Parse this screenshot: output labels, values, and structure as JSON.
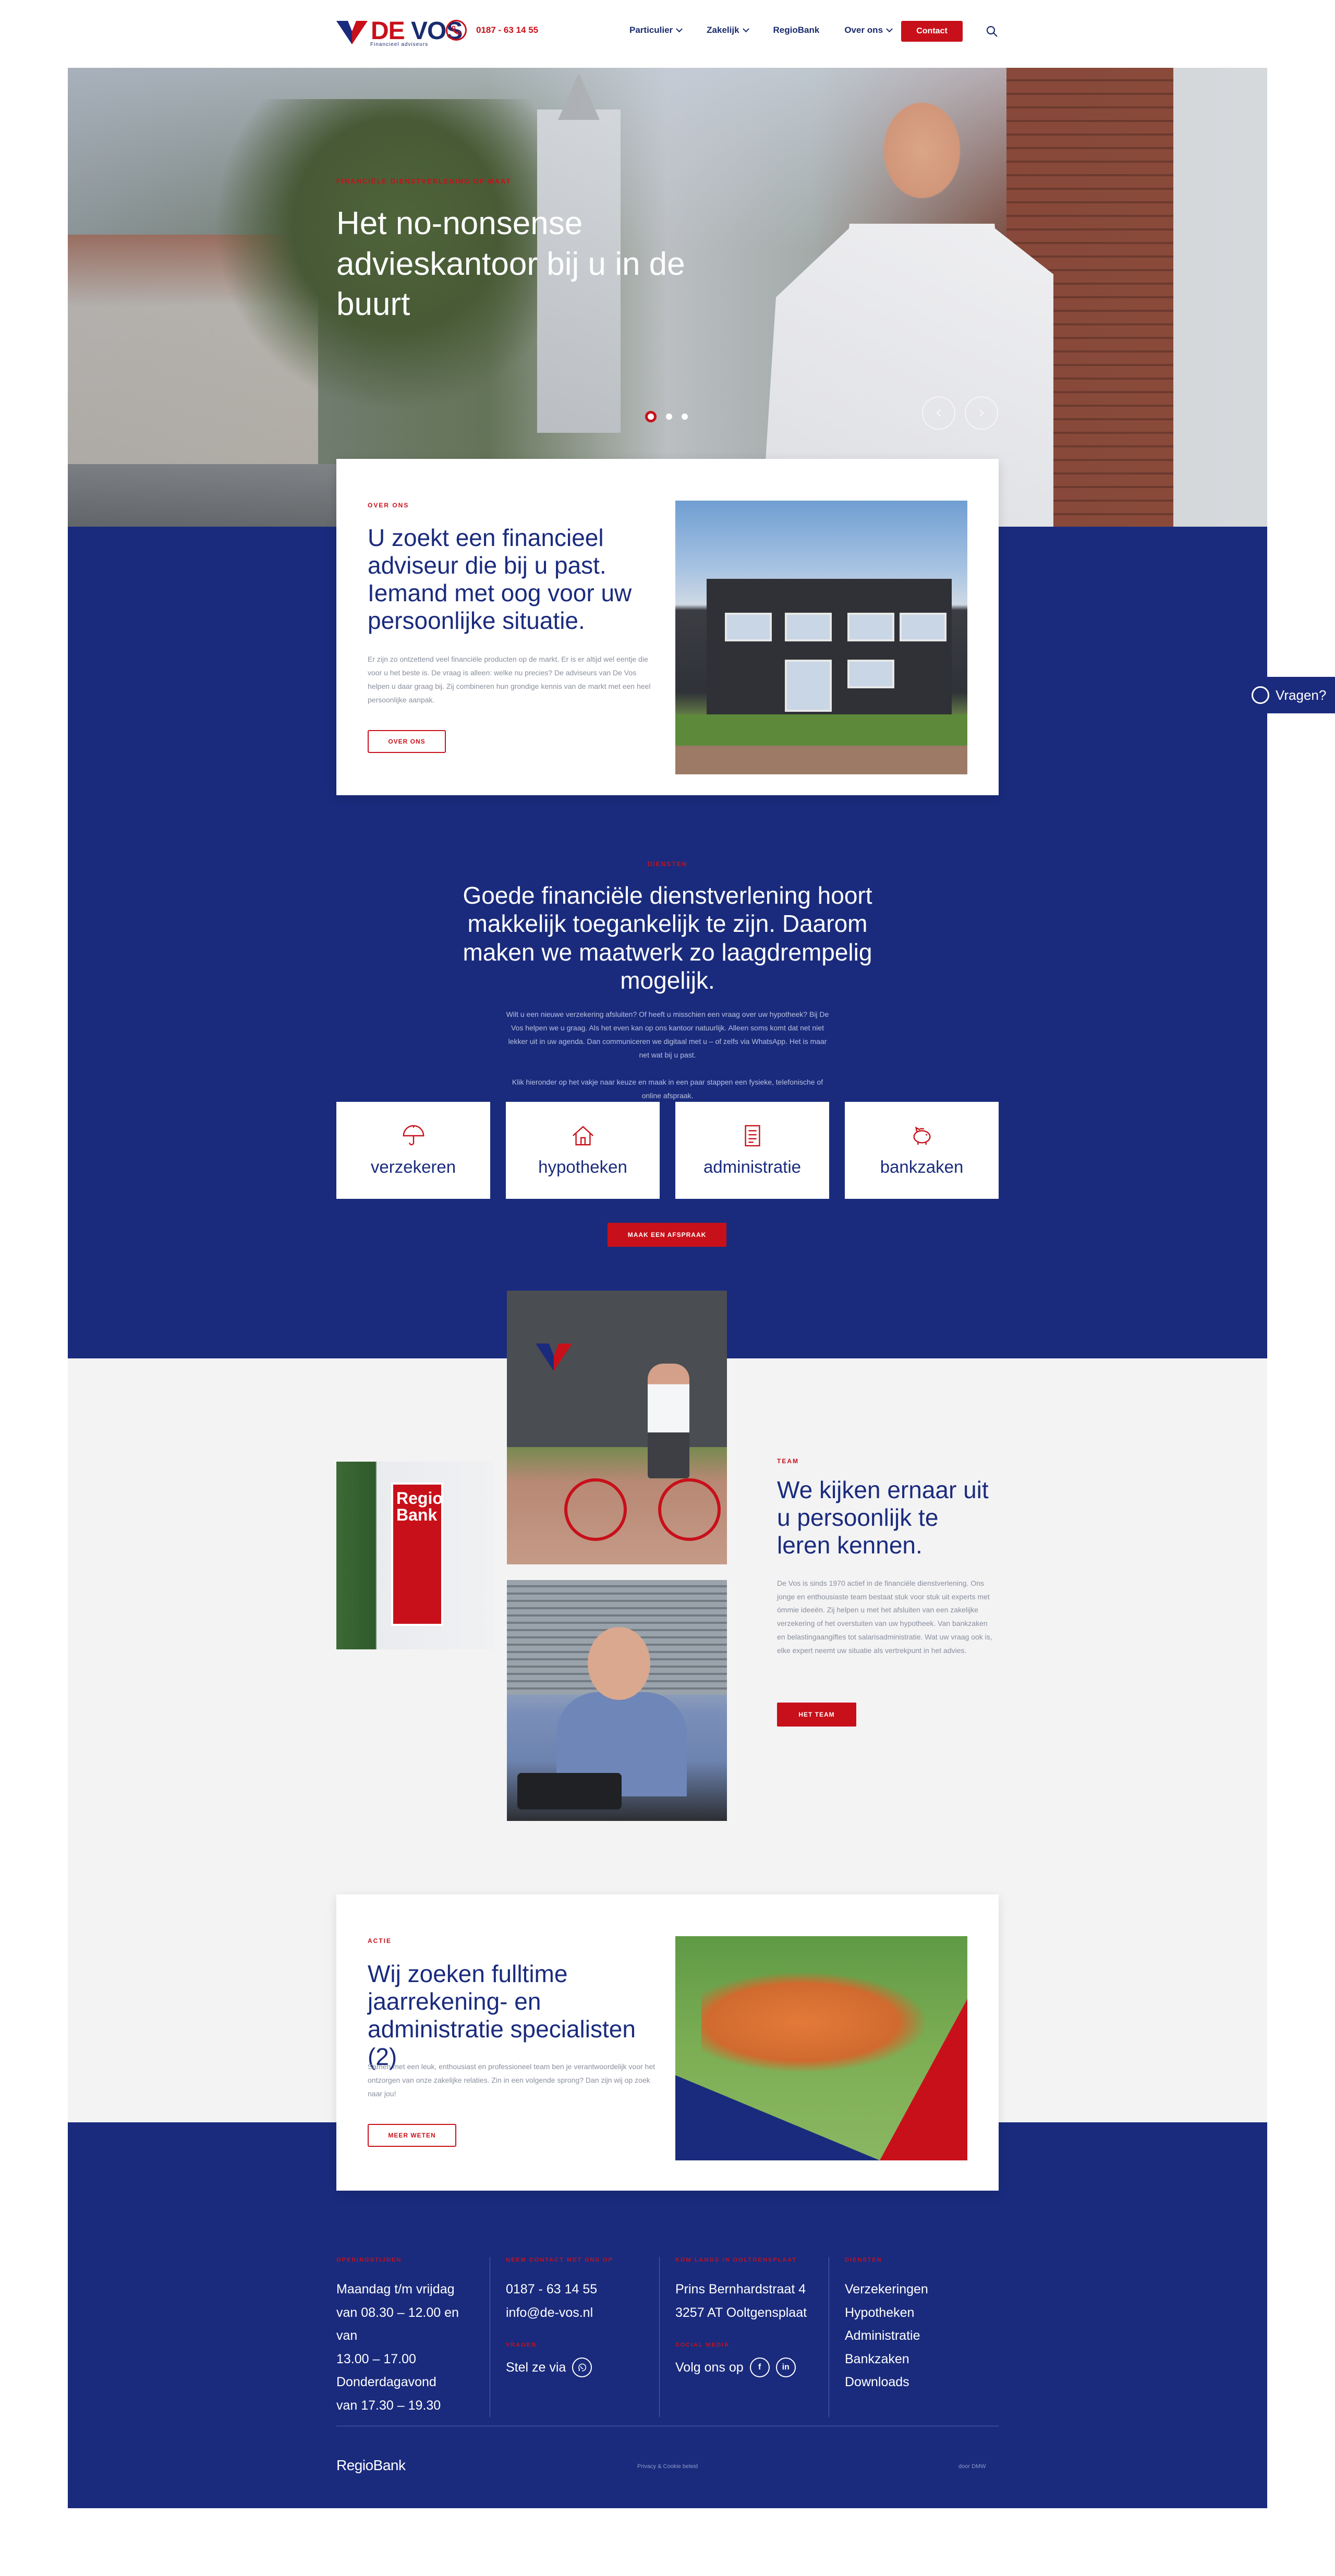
{
  "header": {
    "logo_text": "VOS",
    "logo_prefix": "DE",
    "logo_sub": "Financieel adviseurs",
    "phone": "0187 - 63 14 55",
    "nav": [
      "Particulier",
      "Zakelijk",
      "RegioBank",
      "Over ons"
    ],
    "contact_label": "Contact"
  },
  "hero": {
    "kicker": "FINANCIËLE DIENSTVERLENING OP MAAT",
    "title": "Het no-nonsense advieskantoor bij u in de buurt"
  },
  "about": {
    "kicker": "OVER ONS",
    "title": "U zoekt een financieel adviseur die bij u past. Iemand met oog voor uw persoonlijke situatie.",
    "text": "Er zijn zo ontzettend veel financiële producten op de markt. Er is er altijd wel eentje die voor u het beste is. De vraag is alleen: welke nu precies? De adviseurs van De Vos helpen u daar graag bij. Zij combineren hun grondige kennis van de markt met een heel persoonlijke aanpak.",
    "button": "OVER ONS"
  },
  "diensten": {
    "kicker": "DIENSTEN",
    "title": "Goede financiële dienstverlening hoort makkelijk toegankelijk te zijn. Daarom maken we maatwerk zo laagdrempelig mogelijk.",
    "text1": "Wilt u een nieuwe verzekering afsluiten? Of heeft u misschien een vraag over uw hypotheek? Bij De Vos helpen we u graag. Als het even kan op ons kantoor natuurlijk. Alleen soms komt dat net niet lekker uit in uw agenda. Dan communiceren we digitaal met u – of zelfs via WhatsApp. Het is maar net wat bij u past.",
    "text2": "Klik hieronder op het vakje naar keuze en maak in een paar stappen een fysieke, telefonische of online afspraak.",
    "services": [
      "verzekeren",
      "hypotheken",
      "administratie",
      "bankzaken"
    ],
    "button": "MAAK EEN AFSPRAAK"
  },
  "team": {
    "kicker": "TEAM",
    "title": "We kijken ernaar uit u persoonlijk te leren kennen.",
    "text": "De Vos is sinds 1970 actief in de financiële dienstverlening. Ons jonge en enthousiaste team bestaat stuk voor stuk uit experts met ómmie ideeën. Zij helpen u met het afsluiten van een zakelijke verzekering of het overstuiten van uw hypotheek. Van bankzaken en belastingaangiftes tot salarisadministratie. Wat uw vraag ook is, elke expert neemt uw situatie als vertrekpunt in het advies.",
    "button": "HET TEAM",
    "sign_text": "Regio Bank"
  },
  "vacancy": {
    "kicker": "ACTIE",
    "title": "Wij zoeken fulltime jaarrekening- en administratie specialisten (2)",
    "text": "Samen met een leuk, enthousiast en professioneel team ben je verantwoordelijk voor het ontzorgen van onze zakelijke relaties. Zin in een volgende sprong? Dan zijn wij op zoek naar jou!",
    "button": "MEER WETEN"
  },
  "footer": {
    "c1_kicker": "OPENINGSTIJDEN",
    "c1_lines": [
      "Maandag t/m vrijdag",
      "van 08.30 – 12.00 en van",
      "13.00 – 17.00",
      "Donderdagavond",
      "van 17.30 – 19.30"
    ],
    "c2_kicker": "NEEM CONTACT MET ONS OP",
    "c2_lines": [
      "0187 - 63 14 55",
      "info@de-vos.nl"
    ],
    "c2_sub_kicker": "VRAGEN",
    "c2_sub": "Stel ze via",
    "c3_kicker": "KOM LANGS IN OOLTGENSPLAAT",
    "c3_lines": [
      "Prins Bernhardstraat 4",
      "3257 AT Ooltgensplaat"
    ],
    "c3_sub_kicker": "SOCIAL MEDIA",
    "c3_sub": "Volg ons op",
    "c4_kicker": "DIENSTEN",
    "c4_lines": [
      "Verzekeringen",
      "Hypotheken",
      "Administratie",
      "Bankzaken",
      "Downloads"
    ],
    "regio": "RegioBank",
    "privacy": "Privacy & Cookie beleid",
    "credit": "door DMW"
  },
  "floating": {
    "label": "Vragen?"
  },
  "colors": {
    "brand_blue": "#1a2b7d",
    "brand_red": "#c8101a",
    "grey_bg": "#f3f3f4"
  }
}
